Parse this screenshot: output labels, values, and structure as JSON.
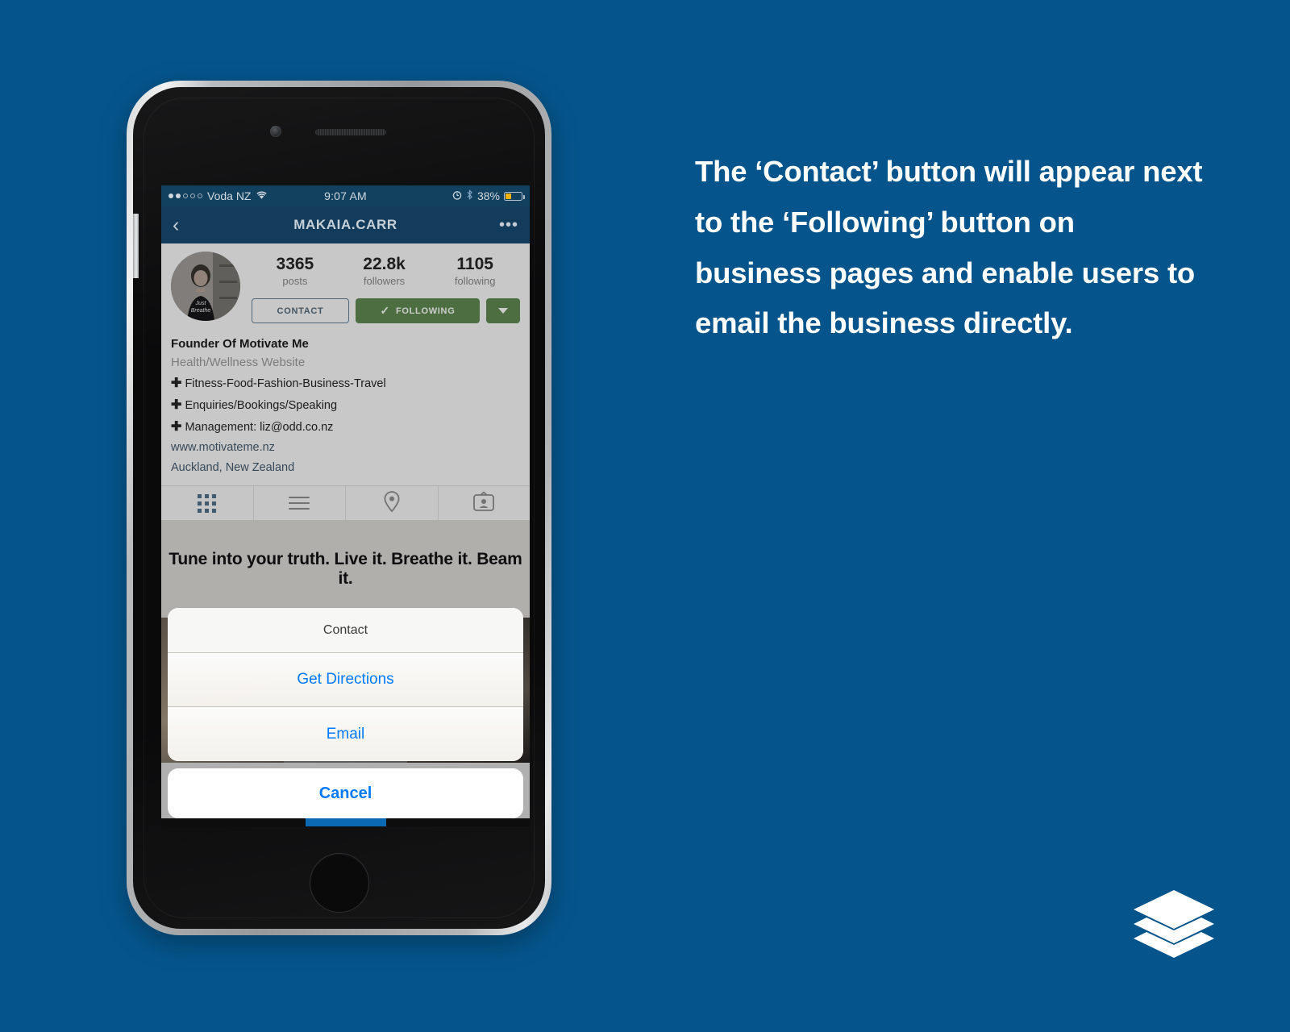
{
  "background_color": "#05558c",
  "caption": {
    "text": "The ‘Contact’ button will appear next to the ‘Following’ button on business pages and enable users to email the business directly."
  },
  "logo": {
    "name": "buffer-logo"
  },
  "phone": {
    "status_bar": {
      "carrier": "Voda NZ",
      "time": "9:07 AM",
      "battery_percent": "38%",
      "signal_dots_filled": 2,
      "signal_dots_total": 5,
      "icons": [
        "wifi-icon",
        "alarm-clock-icon",
        "bluetooth-icon",
        "battery-icon"
      ]
    },
    "nav_bar": {
      "back_label": "‹",
      "title": "MAKAIA.CARR",
      "more_label": "•••"
    },
    "profile": {
      "stats": [
        {
          "value": "3365",
          "label": "posts"
        },
        {
          "value": "22.8k",
          "label": "followers"
        },
        {
          "value": "1105",
          "label": "following"
        }
      ],
      "buttons": {
        "contact": "CONTACT",
        "following": "FOLLOWING",
        "following_color": "#3c9a1c",
        "contact_border_color": "#4a86b8",
        "caret": "▼"
      },
      "bio": {
        "name": "Founder Of Motivate Me",
        "category": "Health/Wellness Website",
        "lines": [
          "Fitness-Food-Fashion-Business-Travel",
          "Enquiries/Bookings/Speaking",
          "Management: liz@odd.co.nz"
        ],
        "website": "www.motivateme.nz",
        "location": "Auckland, New Zealand"
      },
      "tabs": [
        {
          "name": "grid-tab",
          "icon": "grid-icon",
          "active": true
        },
        {
          "name": "list-tab",
          "icon": "list-icon",
          "active": false
        },
        {
          "name": "map-tab",
          "icon": "location-pin-icon",
          "active": false
        },
        {
          "name": "tagged-tab",
          "icon": "id-card-icon",
          "active": false
        }
      ],
      "feed_quote": "Tune into your truth. Live it. Breathe it. Beam it."
    },
    "action_sheet": {
      "title": "Contact",
      "options": [
        "Get Directions",
        "Email"
      ],
      "cancel": "Cancel"
    }
  }
}
